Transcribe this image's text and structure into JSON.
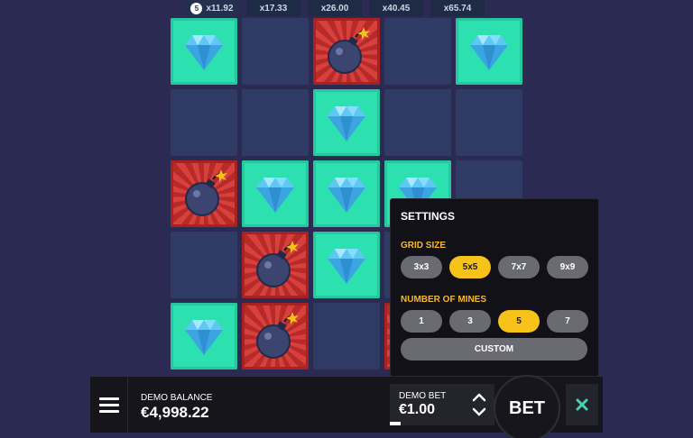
{
  "multipliers": {
    "current_count": "5",
    "items": [
      "x11.92",
      "x17.33",
      "x26.00",
      "x40.45",
      "x65.74"
    ]
  },
  "grid": {
    "rows": [
      [
        "gem",
        "hidden",
        "mine",
        "hidden",
        "gem"
      ],
      [
        "hidden",
        "hidden",
        "gem",
        "hidden",
        "hidden"
      ],
      [
        "mine",
        "gem",
        "gem",
        "gem",
        "hidden"
      ],
      [
        "hidden",
        "mine",
        "gem",
        "hidden",
        "hidden"
      ],
      [
        "gem",
        "mine",
        "hidden",
        "mine",
        "hidden"
      ]
    ]
  },
  "settings": {
    "title": "SETTINGS",
    "grid_size_label": "GRID SIZE",
    "grid_sizes": [
      "3x3",
      "5x5",
      "7x7",
      "9x9"
    ],
    "grid_size_selected": "5x5",
    "mines_label": "NUMBER OF MINES",
    "mines_options": [
      "1",
      "3",
      "5",
      "7"
    ],
    "mines_selected": "5",
    "custom_label": "CUSTOM"
  },
  "bottom_bar": {
    "balance_label": "DEMO BALANCE",
    "balance_value": "€4,998.22",
    "bet_label": "DEMO BET",
    "bet_value": "€1.00",
    "bet_button_label": "BET"
  },
  "icons": {
    "menu": "hamburger-menu-icon",
    "increase": "chevron-up-icon",
    "decrease": "chevron-down-icon",
    "close": "close-icon",
    "gem": "diamond-icon",
    "mine": "bomb-icon"
  },
  "colors": {
    "gem_tile": "#2de0b0",
    "mine_tile": "#d8403c",
    "hidden_tile": "#2f3b64",
    "selected_option": "#f7c21a",
    "section_label": "#f5b92b",
    "close_icon": "#45d3b3"
  }
}
